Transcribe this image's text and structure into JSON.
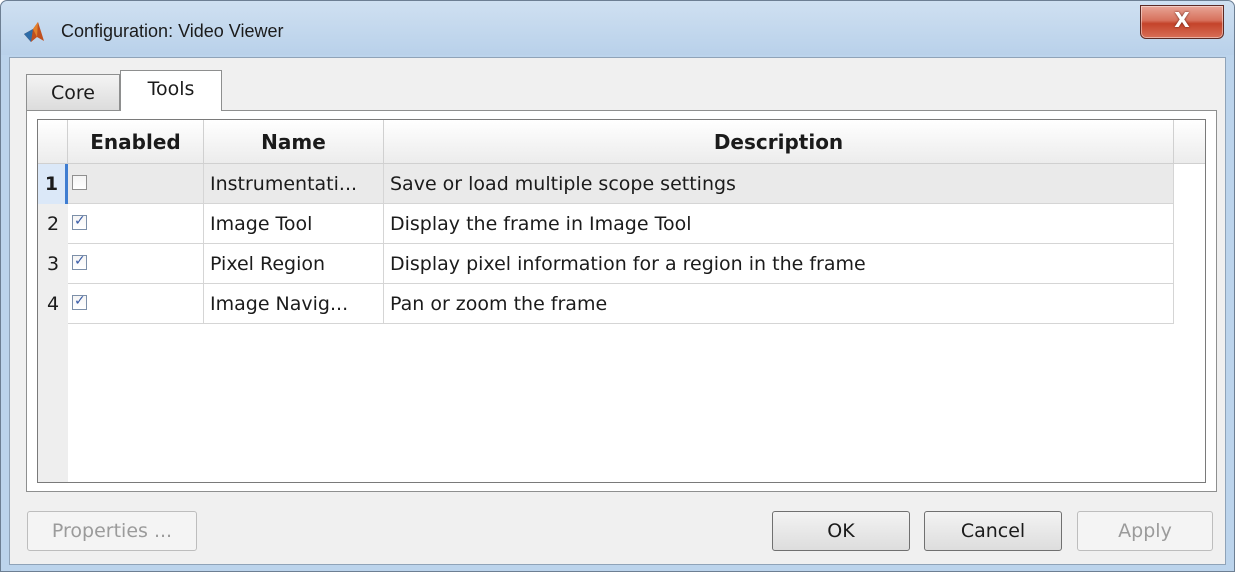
{
  "window": {
    "title": "Configuration: Video Viewer",
    "close_label": "X"
  },
  "tabs": [
    {
      "label": "Core",
      "active": false
    },
    {
      "label": "Tools",
      "active": true
    }
  ],
  "table": {
    "columns": [
      "Enabled",
      "Name",
      "Description"
    ],
    "rows": [
      {
        "num": "1",
        "enabled": false,
        "name": "Instrumentati...",
        "description": "Save or load multiple scope settings",
        "selected": true
      },
      {
        "num": "2",
        "enabled": true,
        "name": "Image Tool",
        "description": "Display the frame in Image Tool",
        "selected": false
      },
      {
        "num": "3",
        "enabled": true,
        "name": "Pixel Region",
        "description": "Display pixel information for a region in the frame",
        "selected": false
      },
      {
        "num": "4",
        "enabled": true,
        "name": "Image Navig...",
        "description": "Pan or zoom the frame",
        "selected": false
      }
    ]
  },
  "buttons": {
    "properties": "Properties ...",
    "ok": "OK",
    "cancel": "Cancel",
    "apply": "Apply"
  },
  "icons": {
    "app": "matlab-icon",
    "check": "✓"
  },
  "colors": {
    "title_bar": "#bcd4ec",
    "close_button": "#c4432a",
    "selection": "#3f7dd1"
  }
}
